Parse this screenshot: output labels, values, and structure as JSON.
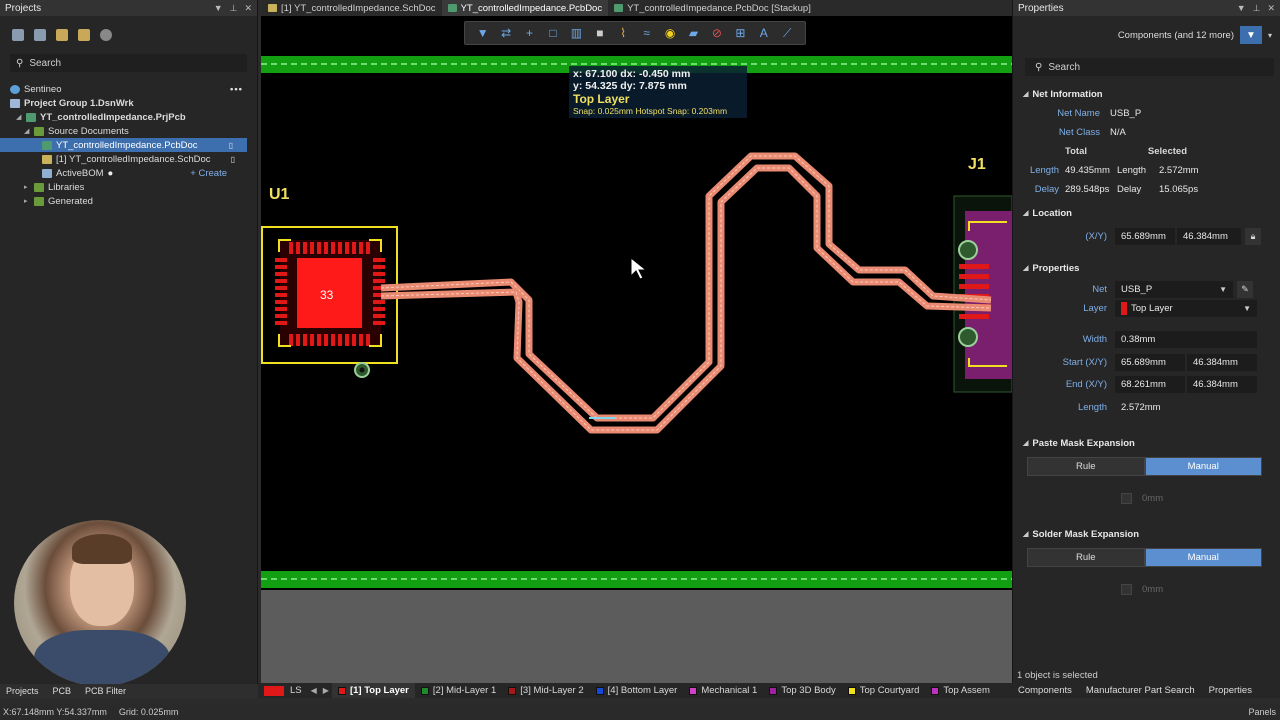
{
  "left_panel": {
    "title": "Projects",
    "search_placeholder": "Search",
    "tree": [
      {
        "label": "Sentineo",
        "icon": "cloud-icon",
        "indent": 0,
        "arrow": ""
      },
      {
        "label": "Project Group 1.DsnWrk",
        "icon": "workspace-icon",
        "indent": 0,
        "arrow": "◢"
      },
      {
        "label": "YT_controlledImpedance.PrjPcb",
        "icon": "pcb-project-icon",
        "indent": 1,
        "arrow": "◢"
      },
      {
        "label": "Source Documents",
        "icon": "folder-icon",
        "indent": 2,
        "arrow": "◢"
      },
      {
        "label": "YT_controlledImpedance.PcbDoc",
        "icon": "pcbdoc-icon",
        "indent": 3,
        "arrow": "",
        "selected": true
      },
      {
        "label": "[1] YT_controlledImpedance.SchDoc",
        "icon": "schdoc-icon",
        "indent": 3,
        "arrow": ""
      },
      {
        "label": "ActiveBOM",
        "icon": "bom-icon",
        "indent": 3,
        "arrow": ""
      },
      {
        "label": "Libraries",
        "icon": "folder-icon",
        "indent": 2,
        "arrow": "▸"
      },
      {
        "label": "Generated",
        "icon": "folder-icon",
        "indent": 2,
        "arrow": "▸"
      }
    ],
    "create_label": "+ Create",
    "bottom_tabs": [
      "Projects",
      "PCB",
      "PCB Filter"
    ]
  },
  "doc_tabs": [
    {
      "label": "[1] YT_controlledImpedance.SchDoc",
      "active": false,
      "color": "#c9b25a"
    },
    {
      "label": "YT_controlledImpedance.PcbDoc",
      "active": true,
      "color": "#4f9a6e"
    },
    {
      "label": "YT_controlledImpedance.PcbDoc [Stackup]",
      "active": false,
      "color": "#4f9a6e"
    }
  ],
  "hud": {
    "line1": "x: 67.100   dx: -0.450 mm",
    "line2": "y: 54.325   dy: 7.875 mm",
    "layer": "Top Layer",
    "snap": "Snap: 0.025mm Hotspot Snap: 0.203mm"
  },
  "canvas": {
    "designator_u1": "U1",
    "designator_j1": "J1",
    "chip_label": "33"
  },
  "layer_bar": {
    "ls_label": "LS",
    "layers": [
      {
        "label": "[1] Top Layer",
        "color": "#e01818",
        "active": true
      },
      {
        "label": "[2] Mid-Layer 1",
        "color": "#1f8a2c",
        "active": false
      },
      {
        "label": "[3] Mid-Layer 2",
        "color": "#a81818",
        "active": false
      },
      {
        "label": "[4] Bottom Layer",
        "color": "#1848d8",
        "active": false
      },
      {
        "label": "Mechanical 1",
        "color": "#d040c8",
        "active": false
      },
      {
        "label": "Top 3D Body",
        "color": "#a020a0",
        "active": false
      },
      {
        "label": "Top Courtyard",
        "color": "#f0e020",
        "active": false
      },
      {
        "label": "Top Assem",
        "color": "#c030c0",
        "active": false
      }
    ]
  },
  "right_panel": {
    "title": "Properties",
    "filter_text": "Components (and 12 more)",
    "search_placeholder": "Search",
    "net_info": {
      "header": "Net Information",
      "net_name_label": "Net Name",
      "net_name": "USB_P",
      "net_class_label": "Net Class",
      "net_class": "N/A",
      "total_label": "Total",
      "selected_label": "Selected",
      "length_label": "Length",
      "length_total": "49.435mm",
      "length_sel_label": "Length",
      "length_sel": "2.572mm",
      "delay_label": "Delay",
      "delay_total": "289.548ps",
      "delay_sel_label": "Delay",
      "delay_sel": "15.065ps"
    },
    "location": {
      "header": "Location",
      "xy_label": "(X/Y)",
      "x": "65.689mm",
      "y": "46.384mm"
    },
    "properties": {
      "header": "Properties",
      "net_label": "Net",
      "net": "USB_P",
      "layer_label": "Layer",
      "layer": "Top Layer",
      "width_label": "Width",
      "width": "0.38mm",
      "start_label": "Start (X/Y)",
      "start_x": "65.689mm",
      "start_y": "46.384mm",
      "end_label": "End (X/Y)",
      "end_x": "68.261mm",
      "end_y": "46.384mm",
      "length_label": "Length",
      "length": "2.572mm"
    },
    "paste_mask": {
      "header": "Paste Mask Expansion",
      "rule": "Rule",
      "manual": "Manual",
      "value": "0mm"
    },
    "solder_mask": {
      "header": "Solder Mask Expansion",
      "rule": "Rule",
      "manual": "Manual",
      "value": "0mm"
    },
    "selection_status": "1 object is selected",
    "bottom_tabs": [
      "Components",
      "Manufacturer Part Search",
      "Properties"
    ]
  },
  "status_bar": {
    "coords": "X:67.148mm Y:54.337mm",
    "grid": "Grid: 0.025mm",
    "panels": "Panels"
  },
  "colors": {
    "trace": "#e98a72",
    "board_edge": "#19b219",
    "component_outline": "#f0e020",
    "pad": "#e01818",
    "accent": "#3d6fae"
  }
}
